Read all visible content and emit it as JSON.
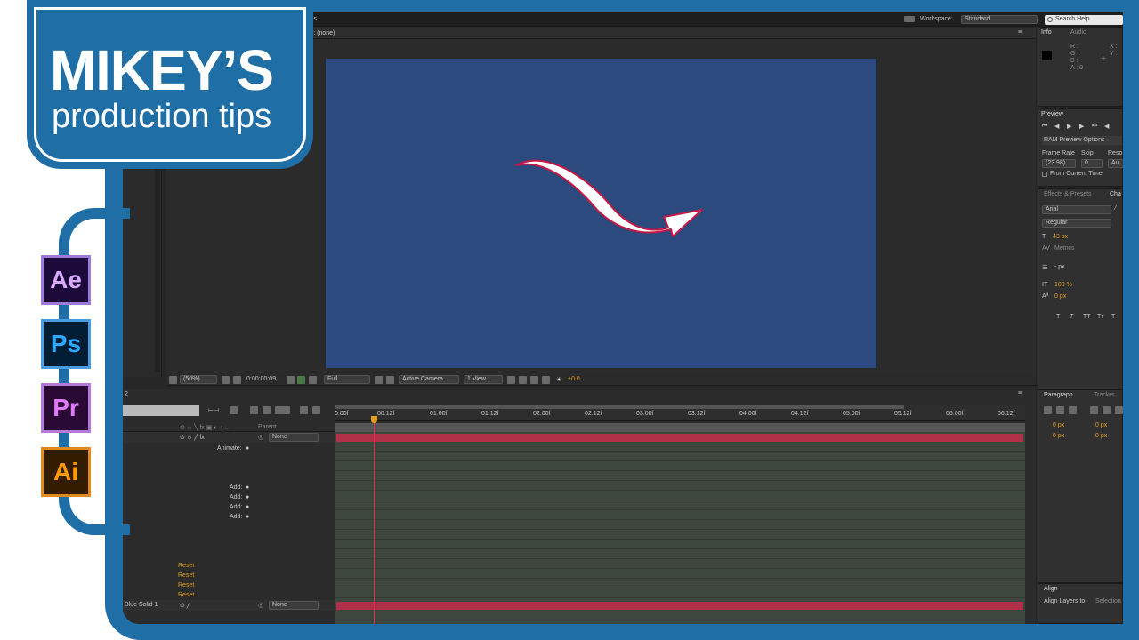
{
  "branding": {
    "title": "MIKEY’S",
    "subtitle": "production tips"
  },
  "apps": [
    {
      "label": "Ae",
      "fg": "#d9a8ff",
      "bg": "#1c0a3a",
      "border": "#9d7ad8"
    },
    {
      "label": "Ps",
      "fg": "#31a8ff",
      "bg": "#001d34",
      "border": "#4a9be0"
    },
    {
      "label": "Pr",
      "fg": "#e07bff",
      "bg": "#2a0a35",
      "border": "#b57ad8"
    },
    {
      "label": "Ai",
      "fg": "#ff9a00",
      "bg": "#331c00",
      "border": "#e08a20"
    }
  ],
  "top": {
    "panels_tab": "nels",
    "workspace_label": "Workspace:",
    "workspace_value": "Standard",
    "search": "Search Help"
  },
  "viewer": {
    "header": "er: (none)",
    "zoom": "(50%)",
    "timecode": "0:00:00:09",
    "resolution": "Full",
    "camera": "Active Camera",
    "views": "1 View",
    "exposure": "+0.0",
    "bg_color": "#2d4a7e"
  },
  "info": {
    "tab": "Info",
    "tab2": "Audio",
    "r": "R :",
    "g": "G :",
    "b": "B :",
    "a": "A : 0",
    "x": "X :",
    "y": "Y :"
  },
  "preview": {
    "tab": "Preview",
    "ram_options": "RAM Preview Options",
    "frame_rate_label": "Frame Rate",
    "skip_label": "Skip",
    "res_label": "Reso",
    "frame_rate": "(23.98)",
    "skip": "0",
    "res": "Au",
    "from_current": "From Current Time"
  },
  "effects": {
    "tab": "Effects & Presets",
    "tab2": "Cha"
  },
  "character": {
    "font": "Arial",
    "style": "Regular",
    "size": "43 px",
    "kerning": "Metrics",
    "leading": "- px",
    "vscale": "100 %",
    "baseline": "0 px",
    "styles": [
      "T",
      "T",
      "TT",
      "Tт",
      "T"
    ]
  },
  "paragraph": {
    "tab": "Paragraph",
    "tab2": "Tracker",
    "indent_values": [
      "0 px",
      "0 px",
      "0 px",
      "0 px"
    ]
  },
  "align": {
    "tab": "Align",
    "label": "Align Layers to:",
    "value": "Selection"
  },
  "timeline": {
    "ruler": [
      "0:00f",
      "00:12f",
      "01:00f",
      "01:12f",
      "02:00f",
      "02:12f",
      "03:00f",
      "03:12f",
      "04:00f",
      "04:12f",
      "05:00f",
      "05:12f",
      "06:00f",
      "06:12f"
    ],
    "parent_header": "Parent",
    "parent_none": "None",
    "animate": "Animate:",
    "add_labels": [
      "Add:",
      "Add:",
      "Add:",
      "Add:"
    ],
    "reset_labels": [
      "Reset",
      "Reset",
      "Reset",
      "Reset"
    ],
    "layer2_name": "Blue Solid 1",
    "layer2_parent": "None",
    "tab_num": "2"
  }
}
